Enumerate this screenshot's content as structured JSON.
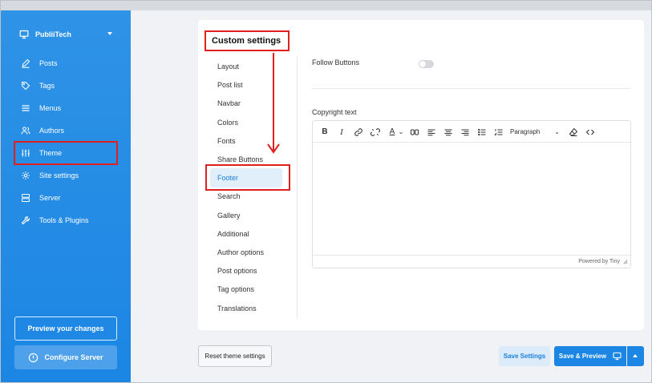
{
  "sidebar": {
    "site_name": "PubliiTech",
    "items": [
      {
        "label": "Posts",
        "icon": "pen-icon"
      },
      {
        "label": "Tags",
        "icon": "tag-icon"
      },
      {
        "label": "Menus",
        "icon": "menu-icon"
      },
      {
        "label": "Authors",
        "icon": "users-icon"
      },
      {
        "label": "Theme",
        "icon": "sliders-icon"
      },
      {
        "label": "Site settings",
        "icon": "gear-icon"
      },
      {
        "label": "Server",
        "icon": "server-icon"
      },
      {
        "label": "Tools & Plugins",
        "icon": "wrench-icon"
      }
    ],
    "preview_label": "Preview your changes",
    "configure_label": "Configure Server"
  },
  "settings": {
    "title": "Custom settings",
    "menu": [
      "Layout",
      "Post list",
      "Navbar",
      "Colors",
      "Fonts",
      "Share Buttons",
      "Footer",
      "Search",
      "Gallery",
      "Additional",
      "Author options",
      "Post options",
      "Tag options",
      "Translations"
    ],
    "active": "Footer"
  },
  "footer": {
    "follow_buttons_label": "Follow Buttons",
    "follow_buttons_on": false,
    "copyright_label": "Copyright text",
    "format_select": "Paragraph",
    "powered_by": "Powered by Tiny"
  },
  "toolbar_icons": [
    "bold-icon",
    "italic-icon",
    "link-icon",
    "unlink-icon",
    "text-color-icon",
    "chevron-down-icon",
    "quote-icon",
    "align-left-icon",
    "align-center-icon",
    "align-right-icon",
    "bullet-list-icon",
    "numbered-list-icon",
    "clear-format-icon",
    "code-icon"
  ],
  "actions": {
    "reset_label": "Reset theme settings",
    "save_label": "Save Settings",
    "save_preview_label": "Save & Preview"
  },
  "colors": {
    "sidebar": "#1b86e4",
    "accent": "#1b86e4",
    "annotation": "#e0201f"
  }
}
